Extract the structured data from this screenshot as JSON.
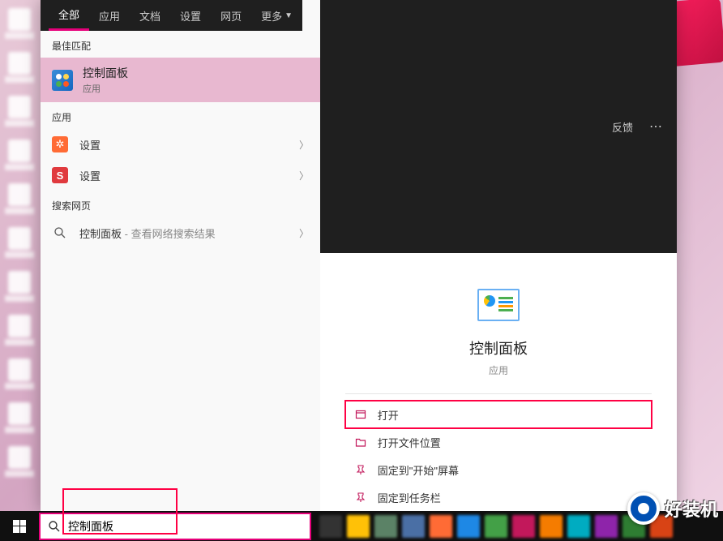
{
  "tabs": {
    "all": "全部",
    "apps": "应用",
    "docs": "文档",
    "settings": "设置",
    "web": "网页",
    "more": "更多",
    "feedback": "反馈"
  },
  "sections": {
    "best_match": "最佳匹配",
    "apps": "应用",
    "web": "搜索网页"
  },
  "best_match": {
    "title": "控制面板",
    "subtitle": "应用"
  },
  "app_results": [
    {
      "label": "设置",
      "icon": "gear-orange"
    },
    {
      "label": "设置",
      "icon": "s-red"
    }
  ],
  "web_results": [
    {
      "label": "控制面板",
      "suffix": " - 查看网络搜索结果"
    }
  ],
  "preview": {
    "title": "控制面板",
    "subtitle": "应用"
  },
  "actions": {
    "open": "打开",
    "open_location": "打开文件位置",
    "pin_start": "固定到\"开始\"屏幕",
    "pin_taskbar": "固定到任务栏"
  },
  "search": {
    "value": "控制面板"
  },
  "watermark": "好装机"
}
